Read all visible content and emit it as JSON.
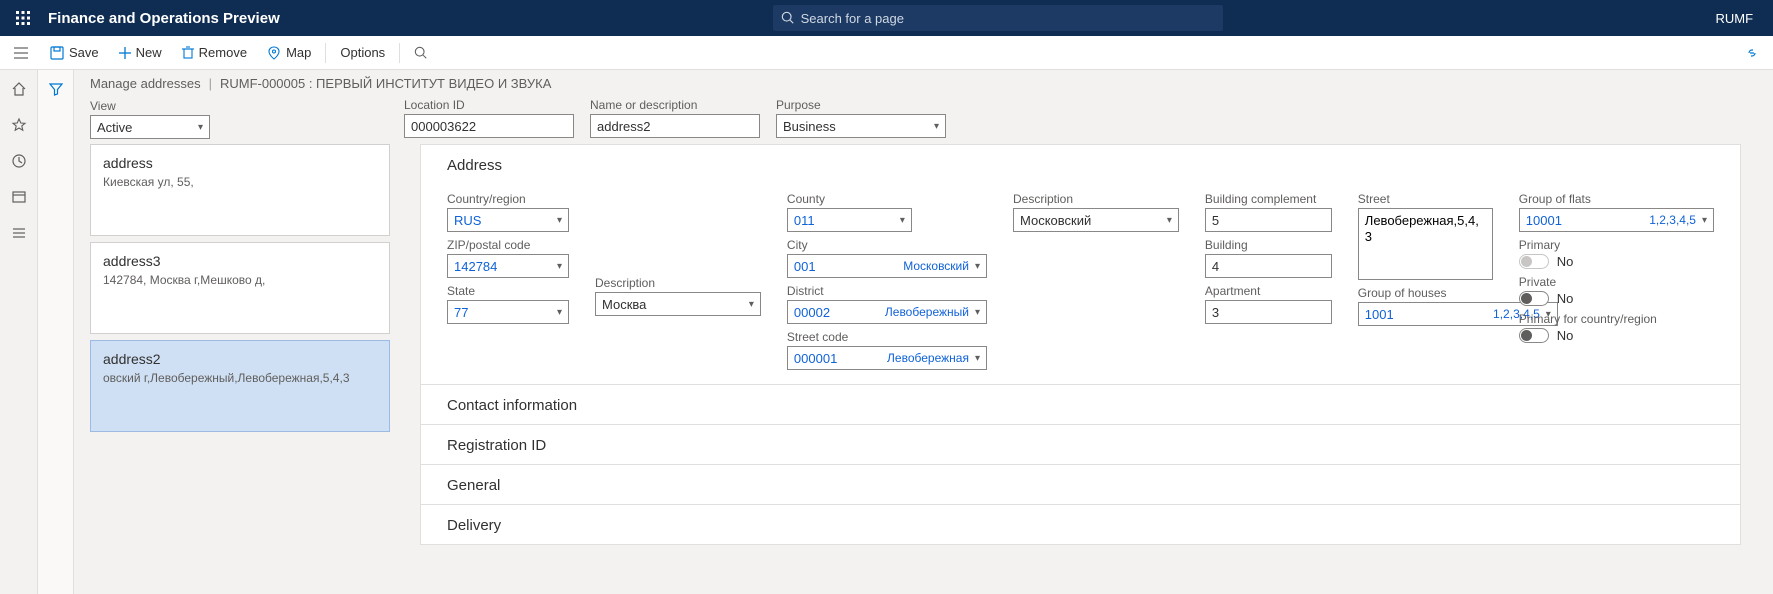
{
  "header": {
    "title": "Finance and Operations Preview",
    "search_placeholder": "Search for a page",
    "company": "RUMF"
  },
  "commands": {
    "save": "Save",
    "new": "New",
    "remove": "Remove",
    "map": "Map",
    "options": "Options"
  },
  "breadcrumb": {
    "page": "Manage addresses",
    "record": "RUMF-000005 : ПЕРВЫЙ ИНСТИТУТ ВИДЕО И ЗВУКА"
  },
  "topfields": {
    "view_label": "View",
    "view_value": "Active",
    "location_id_label": "Location ID",
    "location_id_value": "000003622",
    "name_label": "Name or description",
    "name_value": "address2",
    "purpose_label": "Purpose",
    "purpose_value": "Business"
  },
  "cards": [
    {
      "name": "address",
      "desc": "Киевская ул, 55,"
    },
    {
      "name": "address3",
      "desc": "142784, Москва г,Мешково д,"
    },
    {
      "name": "address2",
      "desc": "овский г,Левобережный,Левобережная,5,4,3"
    }
  ],
  "fasttabs": {
    "address": "Address",
    "contact": "Contact information",
    "registration": "Registration ID",
    "general": "General",
    "delivery": "Delivery"
  },
  "address": {
    "country_label": "Country/region",
    "country_value": "RUS",
    "zip_label": "ZIP/postal code",
    "zip_value": "142784",
    "state_label": "State",
    "state_value": "77",
    "state_desc_label": "Description",
    "state_desc_value": "Москва",
    "county_label": "County",
    "county_value": "011",
    "county_desc_label": "Description",
    "county_desc_value": "Московский",
    "city_label": "City",
    "city_value": "001",
    "city_name": "Московский",
    "district_label": "District",
    "district_value": "00002",
    "district_name": "Левобережный",
    "streetcode_label": "Street code",
    "streetcode_value": "000001",
    "streetcode_name": "Левобережная",
    "bcomp_label": "Building complement",
    "bcomp_value": "5",
    "building_label": "Building",
    "building_value": "4",
    "apt_label": "Apartment",
    "apt_value": "3",
    "street_label": "Street",
    "street_value": "Левобережная,5,4,3",
    "housegroup_label": "Group of houses",
    "housegroup_value": "1001",
    "housegroup_extra": "1,2,3,4,5",
    "flatgroup_label": "Group of flats",
    "flatgroup_value": "10001",
    "flatgroup_extra": "1,2,3,4,5",
    "primary_label": "Primary",
    "primary_value": "No",
    "private_label": "Private",
    "private_value": "No",
    "primary_cr_label": "Primary for country/region",
    "primary_cr_value": "No"
  }
}
